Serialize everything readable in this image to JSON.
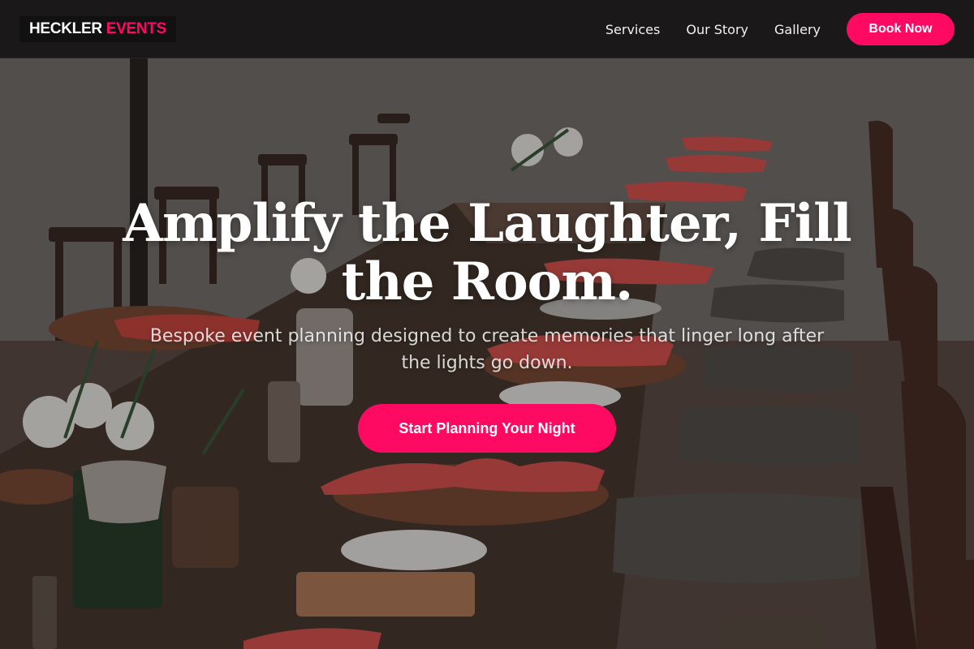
{
  "brand": {
    "part1": "HECKLER",
    "part2": "EVENTS",
    "accent_color": "#ff0a62"
  },
  "nav": {
    "links": [
      {
        "label": "Services"
      },
      {
        "label": "Our Story"
      },
      {
        "label": "Gallery"
      }
    ],
    "cta_label": "Book Now"
  },
  "hero": {
    "title": "Amplify the Laughter, Fill the Room.",
    "subtitle": "Bespoke event planning designed to create memories that linger long after the lights go down.",
    "cta_label": "Start Planning Your Night",
    "background_image": "banquet table with chairs, napkins, plates and glassware"
  }
}
